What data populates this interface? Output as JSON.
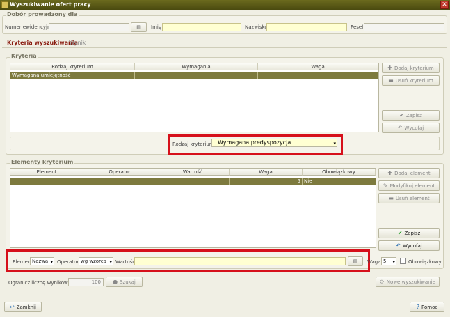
{
  "window": {
    "title": "Wyszukiwanie ofert pracy"
  },
  "dobor": {
    "title": "Dobór prowadzony dla",
    "numer_label": "Numer ewidencyjny",
    "imie_label": "Imię",
    "nazwisko_label": "Nazwisko",
    "pesel_label": "Pesel"
  },
  "tabs": [
    {
      "label": "Kryteria wyszukiwania"
    },
    {
      "label": "Wynik"
    }
  ],
  "kryteria": {
    "title": "Kryteria",
    "columns": [
      "Rodzaj kryterium",
      "Wymagania",
      "Waga"
    ],
    "rows": [
      {
        "rodzaj": "Wymagana umiejętność",
        "wymagania": "",
        "waga": ""
      }
    ],
    "buttons": {
      "add": "Dodaj kryterium",
      "remove": "Usuń kryterium",
      "save": "Zapisz",
      "revert": "Wycofaj"
    },
    "rodzaj_label": "Rodzaj kryterium",
    "rodzaj_value": "Wymagana predyspozycja"
  },
  "elementy": {
    "title": "Elementy kryterium",
    "columns": [
      "Element",
      "Operator",
      "Wartość",
      "Waga",
      "Obowiązkowy"
    ],
    "rows": [
      {
        "element": "",
        "operator": "",
        "wartosc": "",
        "waga": "5",
        "obowiazkowy": "Nie"
      }
    ],
    "buttons": {
      "add": "Dodaj element",
      "modify": "Modyfikuj element",
      "remove": "Usuń element",
      "save": "Zapisz",
      "revert": "Wycofaj"
    },
    "element_label": "Element",
    "element_value": "Nazwa",
    "operator_label": "Operator",
    "operator_value": "wg wzorca",
    "wartosc_label": "Wartość",
    "waga_label": "Waga",
    "waga_value": "5",
    "obowiazkowy_label": "Obowiązkowy"
  },
  "limit": {
    "label": "Ogranicz liczbę wyników do",
    "value": "100",
    "search": "Szukaj",
    "new_search": "Nowe wyszukiwanie"
  },
  "footer": {
    "close": "Zamknij",
    "help": "Pomoc"
  },
  "colors": {
    "highlight": "#d6101b",
    "selected_row": "#7d7a3e",
    "input_yellow": "#ffffd2"
  }
}
